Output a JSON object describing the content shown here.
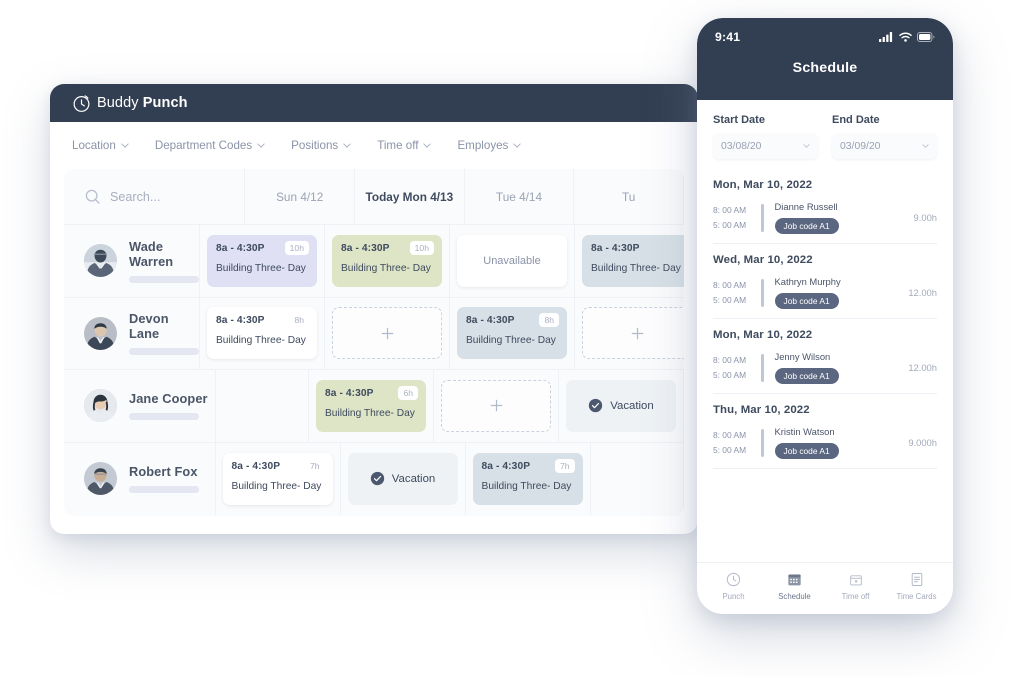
{
  "desktop": {
    "brand": {
      "name_light": "Buddy",
      "name_bold": "Punch",
      "icon": "clock-icon"
    },
    "nav": [
      {
        "label": "Location",
        "icon": "chevron-down-icon"
      },
      {
        "label": "Department Codes",
        "icon": "chevron-down-icon"
      },
      {
        "label": "Positions",
        "icon": "chevron-down-icon"
      },
      {
        "label": "Time off",
        "icon": "chevron-down-icon"
      },
      {
        "label": "Employes",
        "icon": "chevron-down-icon"
      }
    ],
    "search": {
      "placeholder": "Search...",
      "value": "",
      "icon": "search-icon"
    },
    "day_columns": [
      {
        "label": "Sun 4/12",
        "today": false
      },
      {
        "label": "Today Mon 4/13",
        "today": true
      },
      {
        "label": "Tue 4/14",
        "today": false
      },
      {
        "label": "Tu",
        "today": false
      }
    ],
    "employees": [
      {
        "name": "Wade Warren"
      },
      {
        "name": "Devon Lane"
      },
      {
        "name": "Jane Cooper"
      },
      {
        "name": "Robert Fox"
      }
    ],
    "shift_defaults": {
      "time": "8a - 4:30P",
      "title": "Building Three- Day",
      "unavailable_label": "Unavailable",
      "vacation_label": "Vacation",
      "add_icon": "plus-icon",
      "vacation_icon": "check-circle-icon"
    },
    "grid": [
      [
        {
          "type": "shift",
          "time": "8a - 4:30P",
          "title": "Building Three- Day",
          "hours": "10h",
          "color": "lavender"
        },
        {
          "type": "shift",
          "time": "8a - 4:30P",
          "title": "Building Three- Day",
          "hours": "10h",
          "color": "green"
        },
        {
          "type": "state",
          "label": "Unavailable"
        },
        {
          "type": "shift",
          "time": "8a - 4:30P",
          "title": "Building Three- Day",
          "hours": "",
          "color": "bluegray"
        }
      ],
      [
        {
          "type": "shift",
          "time": "8a - 4:30P",
          "title": "Building Three- Day",
          "hours": "8h",
          "color": "white"
        },
        {
          "type": "add"
        },
        {
          "type": "shift",
          "time": "8a - 4:30P",
          "title": "Building Three- Day",
          "hours": "8h",
          "color": "bluegray"
        },
        {
          "type": "add"
        }
      ],
      [
        {
          "type": "empty"
        },
        {
          "type": "shift",
          "time": "8a - 4:30P",
          "title": "Building Three- Day",
          "hours": "6h",
          "color": "green"
        },
        {
          "type": "add"
        },
        {
          "type": "vacation",
          "label": "Vacation"
        }
      ],
      [
        {
          "type": "shift",
          "time": "8a - 4:30P",
          "title": "Building Three- Day",
          "hours": "7h",
          "color": "white"
        },
        {
          "type": "vacation",
          "label": "Vacation"
        },
        {
          "type": "shift",
          "time": "8a - 4:30P",
          "title": "Building Three- Day",
          "hours": "7h",
          "color": "bluegray"
        },
        {
          "type": "empty"
        }
      ]
    ]
  },
  "phone": {
    "status": {
      "time": "9:41",
      "icons": [
        "signal-icon",
        "wifi-icon",
        "battery-icon"
      ]
    },
    "title": "Schedule",
    "start_date": {
      "label": "Start Date",
      "value": "03/08/20",
      "icon": "chevron-down-icon"
    },
    "end_date": {
      "label": "End Date",
      "value": "03/09/20",
      "icon": "chevron-down-icon"
    },
    "groups": [
      {
        "date": "Mon, Mar 10, 2022",
        "start_time": "8: 00 AM",
        "end_time": "5: 00 AM",
        "name": "Dianne Russell",
        "job_code": "Job code A1",
        "hours": "9.00h"
      },
      {
        "date": "Wed, Mar 10, 2022",
        "start_time": "8: 00 AM",
        "end_time": "5: 00 AM",
        "name": "Kathryn Murphy",
        "job_code": "Job code A1",
        "hours": "12.00h"
      },
      {
        "date": "Mon, Mar 10, 2022",
        "start_time": "8: 00 AM",
        "end_time": "5: 00 AM",
        "name": "Jenny Wilson",
        "job_code": "Job code A1",
        "hours": "12.00h"
      },
      {
        "date": "Thu, Mar 10, 2022",
        "start_time": "8: 00 AM",
        "end_time": "5: 00 AM",
        "name": "Kristin Watson",
        "job_code": "Job code A1",
        "hours": "9.000h"
      }
    ],
    "tabs": [
      {
        "label": "Punch",
        "icon": "clock-icon",
        "active": false
      },
      {
        "label": "Schedule",
        "icon": "calendar-grid-icon",
        "active": true
      },
      {
        "label": "Time off",
        "icon": "calendar-icon",
        "active": false
      },
      {
        "label": "Time Cards",
        "icon": "document-icon",
        "active": false
      }
    ]
  },
  "colors": {
    "header_navy": "#323E52",
    "card_lavender": "#DFE0F3",
    "card_green": "#DEE5C6",
    "card_bluegray": "#D7E0E6",
    "chip_navy": "#5B6780"
  }
}
